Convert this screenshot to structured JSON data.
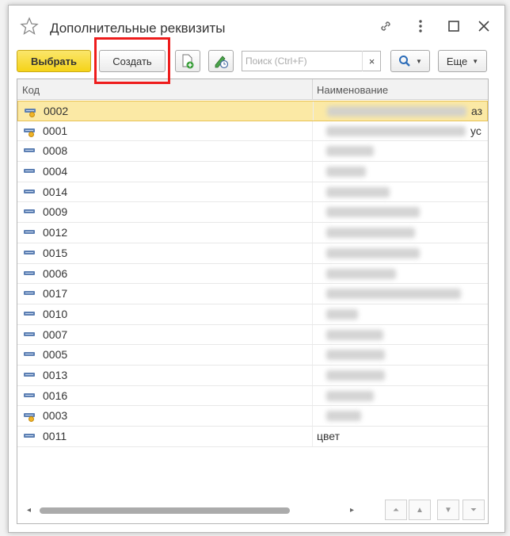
{
  "window": {
    "title": "Дополнительные реквизиты"
  },
  "titlebar": {
    "icons": [
      "star-icon",
      "link-icon",
      "more-icon",
      "maximize-icon",
      "close-icon"
    ]
  },
  "toolbar": {
    "select_label": "Выбрать",
    "create_label": "Создать",
    "search_placeholder": "Поиск (Ctrl+F)",
    "clear_label": "×",
    "more_label": "Еще"
  },
  "table": {
    "columns": [
      "Код",
      "Наименование"
    ],
    "rows": [
      {
        "code": "0002",
        "name": "",
        "selected": true,
        "flag": true,
        "blur_w": 176,
        "tail": "аз"
      },
      {
        "code": "0001",
        "name": "",
        "selected": false,
        "flag": true,
        "blur_w": 176,
        "tail": "ус"
      },
      {
        "code": "0008",
        "name": "",
        "selected": false,
        "flag": false,
        "blur_w": 60,
        "tail": ""
      },
      {
        "code": "0004",
        "name": "",
        "selected": false,
        "flag": false,
        "blur_w": 50,
        "tail": ""
      },
      {
        "code": "0014",
        "name": "",
        "selected": false,
        "flag": false,
        "blur_w": 80,
        "tail": ""
      },
      {
        "code": "0009",
        "name": "",
        "selected": false,
        "flag": false,
        "blur_w": 118,
        "tail": ""
      },
      {
        "code": "0012",
        "name": "",
        "selected": false,
        "flag": false,
        "blur_w": 112,
        "tail": ""
      },
      {
        "code": "0015",
        "name": "",
        "selected": false,
        "flag": false,
        "blur_w": 118,
        "tail": ""
      },
      {
        "code": "0006",
        "name": "",
        "selected": false,
        "flag": false,
        "blur_w": 88,
        "tail": ""
      },
      {
        "code": "0017",
        "name": "",
        "selected": false,
        "flag": false,
        "blur_w": 170,
        "tail": ""
      },
      {
        "code": "0010",
        "name": "",
        "selected": false,
        "flag": false,
        "blur_w": 40,
        "tail": ""
      },
      {
        "code": "0007",
        "name": "",
        "selected": false,
        "flag": false,
        "blur_w": 72,
        "tail": ""
      },
      {
        "code": "0005",
        "name": "",
        "selected": false,
        "flag": false,
        "blur_w": 74,
        "tail": ""
      },
      {
        "code": "0013",
        "name": "",
        "selected": false,
        "flag": false,
        "blur_w": 74,
        "tail": ""
      },
      {
        "code": "0016",
        "name": "",
        "selected": false,
        "flag": false,
        "blur_w": 60,
        "tail": ""
      },
      {
        "code": "0003",
        "name": "",
        "selected": false,
        "flag": true,
        "blur_w": 44,
        "tail": ""
      },
      {
        "code": "0011",
        "name": "цвет",
        "selected": false,
        "flag": false,
        "blur_w": 0,
        "tail": ""
      }
    ]
  },
  "colors": {
    "primary_button": "#f5d318",
    "selected_row": "#fbe9a5",
    "highlight_frame": "#ee1c1c"
  }
}
